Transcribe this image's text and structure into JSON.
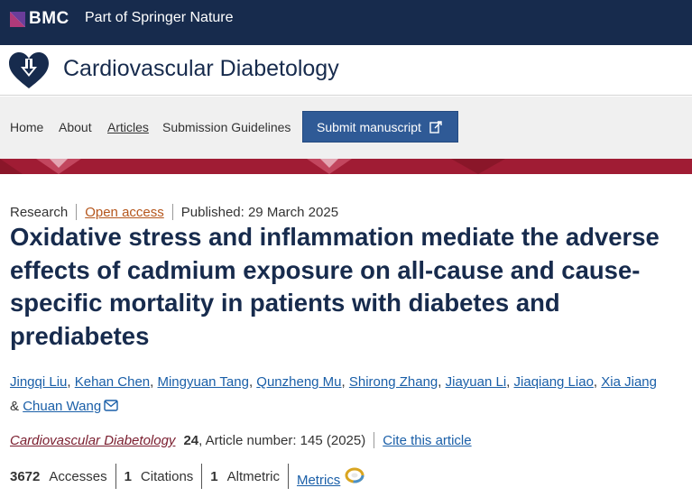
{
  "header": {
    "brand": "BMC",
    "tagline": "Part of Springer Nature"
  },
  "journal": {
    "title": "Cardiovascular Diabetology"
  },
  "nav": {
    "items": [
      {
        "label": "Home"
      },
      {
        "label": "About"
      },
      {
        "label": "Articles"
      },
      {
        "label": "Submission Guidelines"
      }
    ],
    "submit_label": "Submit manuscript"
  },
  "article": {
    "type": "Research",
    "access": "Open access",
    "published": "Published: 29 March 2025",
    "title": "Oxidative stress and inflammation mediate the adverse effects of cadmium exposure on all-cause and cause-specific mortality in patients with diabetes and prediabetes",
    "authors": [
      "Jingqi Liu",
      "Kehan Chen",
      "Mingyuan Tang",
      "Qunzheng Mu",
      "Shirong Zhang",
      "Jiayuan Li",
      "Jiaqiang Liao",
      "Xia Jiang",
      "Chuan Wang"
    ],
    "ampersand": "&",
    "citation": {
      "journal": "Cardiovascular Diabetology",
      "volume": "24",
      "article_number": ", Article number: 145 (2025)",
      "cite_label": "Cite this article"
    },
    "metrics": {
      "accesses_value": "3672",
      "accesses_label": "Accesses",
      "citations_value": "1",
      "citations_label": "Citations",
      "altmetric_value": "1",
      "altmetric_label": "Altmetric",
      "metrics_link": "Metrics"
    }
  },
  "colors": {
    "topbar": "#172b4d",
    "banner": "#a01c34",
    "button": "#2f5a96",
    "link": "#1a5fa8"
  }
}
